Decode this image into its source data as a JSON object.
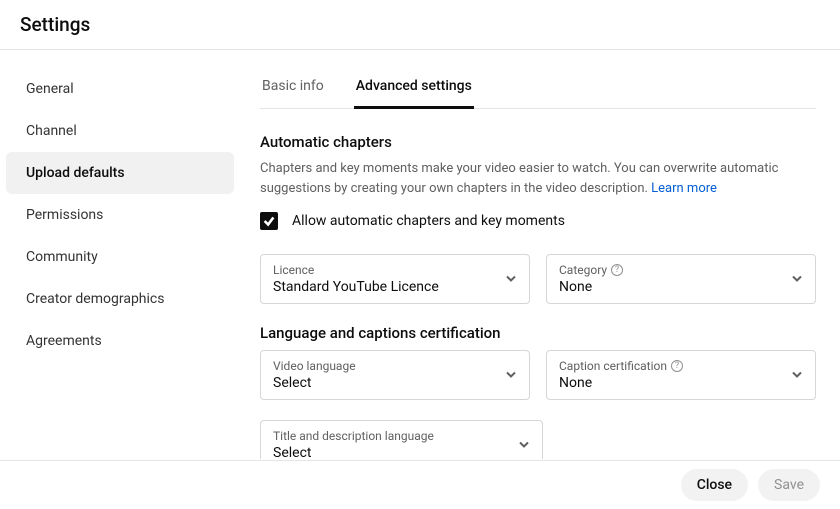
{
  "header": {
    "title": "Settings"
  },
  "sidebar": {
    "items": [
      {
        "label": "General"
      },
      {
        "label": "Channel"
      },
      {
        "label": "Upload defaults"
      },
      {
        "label": "Permissions"
      },
      {
        "label": "Community"
      },
      {
        "label": "Creator demographics"
      },
      {
        "label": "Agreements"
      }
    ],
    "active_index": 2
  },
  "tabs": {
    "items": [
      {
        "label": "Basic info"
      },
      {
        "label": "Advanced settings"
      }
    ],
    "active_index": 1
  },
  "chapters": {
    "title": "Automatic chapters",
    "desc": "Chapters and key moments make your video easier to watch. You can overwrite automatic suggestions by creating your own chapters in the video description. ",
    "learn_more": "Learn more",
    "checkbox_checked": true,
    "checkbox_label": "Allow automatic chapters and key moments"
  },
  "fields": {
    "licence": {
      "label": "Licence",
      "value": "Standard YouTube Licence"
    },
    "category": {
      "label": "Category",
      "value": "None",
      "help": true
    },
    "lang_section_title": "Language and captions certification",
    "video_lang": {
      "label": "Video language",
      "value": "Select"
    },
    "caption_cert": {
      "label": "Caption certification",
      "value": "None",
      "help": true
    },
    "title_lang": {
      "label": "Title and description language",
      "value": "Select"
    }
  },
  "footer": {
    "close": "Close",
    "save": "Save"
  }
}
